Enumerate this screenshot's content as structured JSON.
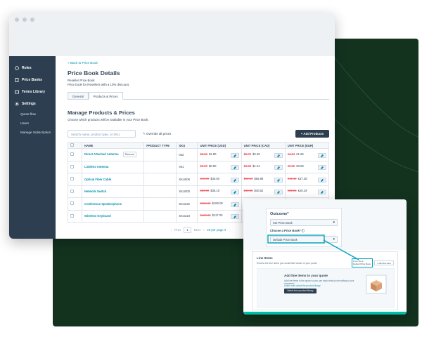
{
  "sidebar": {
    "items": [
      {
        "label": "Roles",
        "icon": "roles-icon"
      },
      {
        "label": "Price Books",
        "icon": "price-books-icon"
      },
      {
        "label": "Terms Library",
        "icon": "terms-library-icon"
      },
      {
        "label": "Settings",
        "icon": "settings-icon"
      }
    ],
    "subitems": [
      "Quote flow",
      "Users",
      "Manage Subscription"
    ]
  },
  "page": {
    "back_link": "< Back to Price Book",
    "title": "Price Book Details",
    "subtitle": "Reseller Price Book",
    "description": "Price book for Resellers with a 10% discount.",
    "tabs": [
      "General",
      "Products & Prices"
    ],
    "section_title": "Manage Products & Prices",
    "section_desc": "Choose which products will be available in your Price Book.",
    "search_placeholder": "Search name, product type, or SKU",
    "override_label": "Override all prices",
    "add_button": "+ Add Products"
  },
  "table": {
    "headers": [
      "NAME",
      "PRODUCT TYPE",
      "SKU",
      "UNIT PRICE (USD)",
      "UNIT PRICE (CAD)",
      "UNIT PRICE (EUR)"
    ],
    "rows": [
      {
        "name": "Direct Attached Antenna",
        "remove": "Remove",
        "type": "",
        "sku": "002",
        "usd_old": "$2.00",
        "usd": "$1.80",
        "cad_old": "$2.76",
        "cad": "$2.48",
        "eur_old": "€1.84",
        "eur": "€1.66"
      },
      {
        "name": "Lickless Antenna",
        "remove": "",
        "type": "",
        "sku": "001",
        "usd_old": "$1.00",
        "usd": "$0.90",
        "cad_old": "$1.38",
        "cad": "$1.24",
        "eur_old": "€0.92",
        "eur": "€0.83"
      },
      {
        "name": "Optical Fiber Cable",
        "remove": "",
        "type": "",
        "sku": "SKU006",
        "usd_old": "$45.00",
        "usd": "$40.50",
        "cad_old": "$62.10",
        "cad": "$55.89",
        "eur_old": "€41.42",
        "eur": "€37.28"
      },
      {
        "name": "Network Switch",
        "remove": "",
        "type": "",
        "sku": "SKU000",
        "usd_old": "$39.00",
        "usd": "$35.10",
        "cad_old": "$49.35",
        "cad": "$40.52",
        "eur_old": "€32.21",
        "eur": "€28.19"
      },
      {
        "name": "Conference Speakerphone",
        "remove": "",
        "type": "",
        "sku": "SKU222",
        "usd_old": "$200.00",
        "usd": "$180.00",
        "cad_old": "$276.00",
        "cad": "$248.40",
        "eur_old": "€184.00",
        "eur": "€165.60"
      },
      {
        "name": "Wireless Keyboard",
        "remove": "",
        "type": "",
        "sku": "SKU223",
        "usd_old": "$130.00",
        "usd": "$117.00",
        "cad_old": "$179.40",
        "cad": "$161.46",
        "eur_old": "€119.60",
        "eur": "€107.64"
      }
    ]
  },
  "pager": {
    "prev": "Prev",
    "page": "1",
    "next": "Next",
    "per_page": "25 per page ▾"
  },
  "popup": {
    "outcome_label": "Outcome*",
    "outcome_value": "Set Price Book",
    "choose_label": "Choose a Price Book* ⓘ",
    "choose_value": "Default Price Book",
    "line_items_title": "Line Items",
    "line_items_sub": "Review the line items you would like shown in your quote",
    "mini_label": "Price Book",
    "mini_value": "Default Price Book",
    "mini_button": "+ Add line item",
    "add_title": "Add line items to your quote",
    "add_desc": "Add line items to the quote so you can track what you're selling to your customers",
    "add_link": "Learn more about the product library",
    "add_button": "Select from product library"
  },
  "colors": {
    "accent": "#0091ae",
    "sidebar": "#2d3e50",
    "green_panel": "#13331f",
    "teal": "#00bda5",
    "strike": "#f2545b"
  }
}
